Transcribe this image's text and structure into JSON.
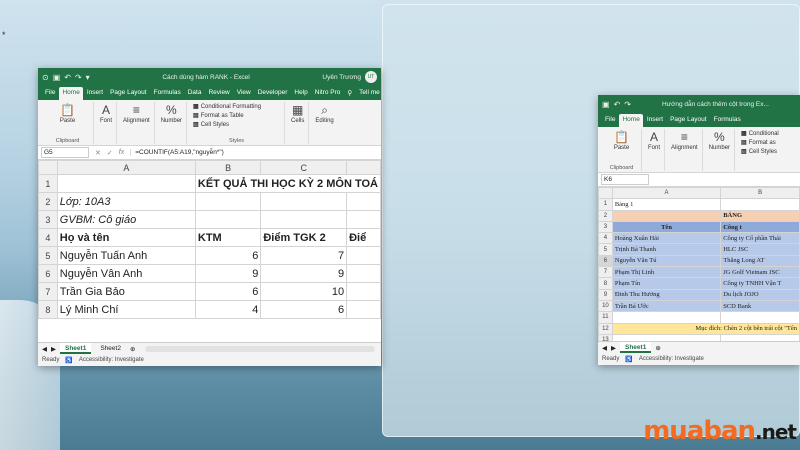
{
  "desktop": {
    "brand_main": "muaban",
    "brand_tld": ".net",
    "star": "*"
  },
  "win1": {
    "title": "Cách dùng hàm RANK - Excel",
    "user": "Uyên Trương",
    "avatar": "UT",
    "tabs": [
      "File",
      "Home",
      "Insert",
      "Page Layout",
      "Formulas",
      "Data",
      "Review",
      "View",
      "Developer",
      "Help",
      "Nitro Pro",
      "Tell me"
    ],
    "ribbon": {
      "paste": "Paste",
      "clipboard": "Clipboard",
      "font": "Font",
      "alignment": "Alignment",
      "number": "Number",
      "cond": "Conditional Formatting",
      "fmt_table": "Format as Table",
      "cell_styles": "Cell Styles",
      "styles": "Styles",
      "cells": "Cells",
      "editing": "Editing"
    },
    "namebox": "G5",
    "formula": "=COUNTIF(A5:A19,\"nguyễn*\")",
    "cols": [
      "A",
      "B",
      "C"
    ],
    "rows": [
      {
        "n": "1",
        "a": "",
        "b": "KẾT QUẢ THI HỌC KỲ 2 MÔN TOÁ",
        "c": ""
      },
      {
        "n": "2",
        "a": "Lớp: 10A3",
        "b": "",
        "c": ""
      },
      {
        "n": "3",
        "a": "GVBM: Cô giáo",
        "b": "",
        "c": ""
      },
      {
        "n": "4",
        "a": "Họ và tên",
        "b": "KTM",
        "c": "Điểm TGK 2",
        "d": "Điể"
      },
      {
        "n": "5",
        "a": "Nguyễn Tuấn Anh",
        "b": "6",
        "c": "7"
      },
      {
        "n": "6",
        "a": "Nguyễn Vân Anh",
        "b": "9",
        "c": "9"
      },
      {
        "n": "7",
        "a": "Trần Gia Bảo",
        "b": "6",
        "c": "10"
      },
      {
        "n": "8",
        "a": "Lý Minh Chí",
        "b": "4",
        "c": "6"
      }
    ],
    "sheets": [
      "Sheet1",
      "Sheet2"
    ],
    "status": {
      "ready": "Ready",
      "access": "Accessibility: Investigate"
    }
  },
  "win2": {
    "title": "Hướng dẫn cách thêm cột trong Ex...",
    "tabs": [
      "File",
      "Home",
      "Insert",
      "Page Layout",
      "Formulas"
    ],
    "ribbon": {
      "paste": "Paste",
      "clipboard": "Clipboard",
      "font": "Font",
      "alignment": "Alignment",
      "number": "Number",
      "cond": "Conditional",
      "fmt_table": "Format as",
      "cell_styles": "Cell Styles"
    },
    "namebox": "K6",
    "cols": [
      "A",
      "B"
    ],
    "rows": [
      {
        "n": "1",
        "a": "Bảng 1",
        "b": ""
      },
      {
        "n": "2",
        "a": "",
        "b": "BẢNG"
      },
      {
        "n": "3",
        "a": "Tên",
        "b": "Công t"
      },
      {
        "n": "4",
        "a": "Hoàng Xuân Hải",
        "b": "Công ty Cổ phần Thái"
      },
      {
        "n": "5",
        "a": "Trịnh Bá Thanh",
        "b": "HLC JSC"
      },
      {
        "n": "6",
        "a": "Nguyễn Văn Tú",
        "b": "Thăng Long AT"
      },
      {
        "n": "7",
        "a": "Phạm Thị Linh",
        "b": "JG Golf Vietnam JSC"
      },
      {
        "n": "8",
        "a": "Phạm Tín",
        "b": "Công ty TNHH Vận T"
      },
      {
        "n": "9",
        "a": "Đinh Thu Hương",
        "b": "Du lịch JOJO"
      },
      {
        "n": "10",
        "a": "Trần Bá Ước",
        "b": "SCD Bank"
      },
      {
        "n": "11",
        "a": "",
        "b": ""
      },
      {
        "n": "12",
        "a": "Mục đích: Chèn 2 cột bên trái cột \"Tên",
        "b": ""
      },
      {
        "n": "13",
        "a": "",
        "b": ""
      },
      {
        "n": "14",
        "a": "",
        "b": ""
      },
      {
        "n": "15",
        "a": "",
        "b": ""
      },
      {
        "n": "16",
        "a": "",
        "b": ""
      }
    ],
    "sheets": [
      "Sheet1"
    ],
    "status": {
      "ready": "Ready",
      "access": "Accessibility: Investigate"
    }
  }
}
